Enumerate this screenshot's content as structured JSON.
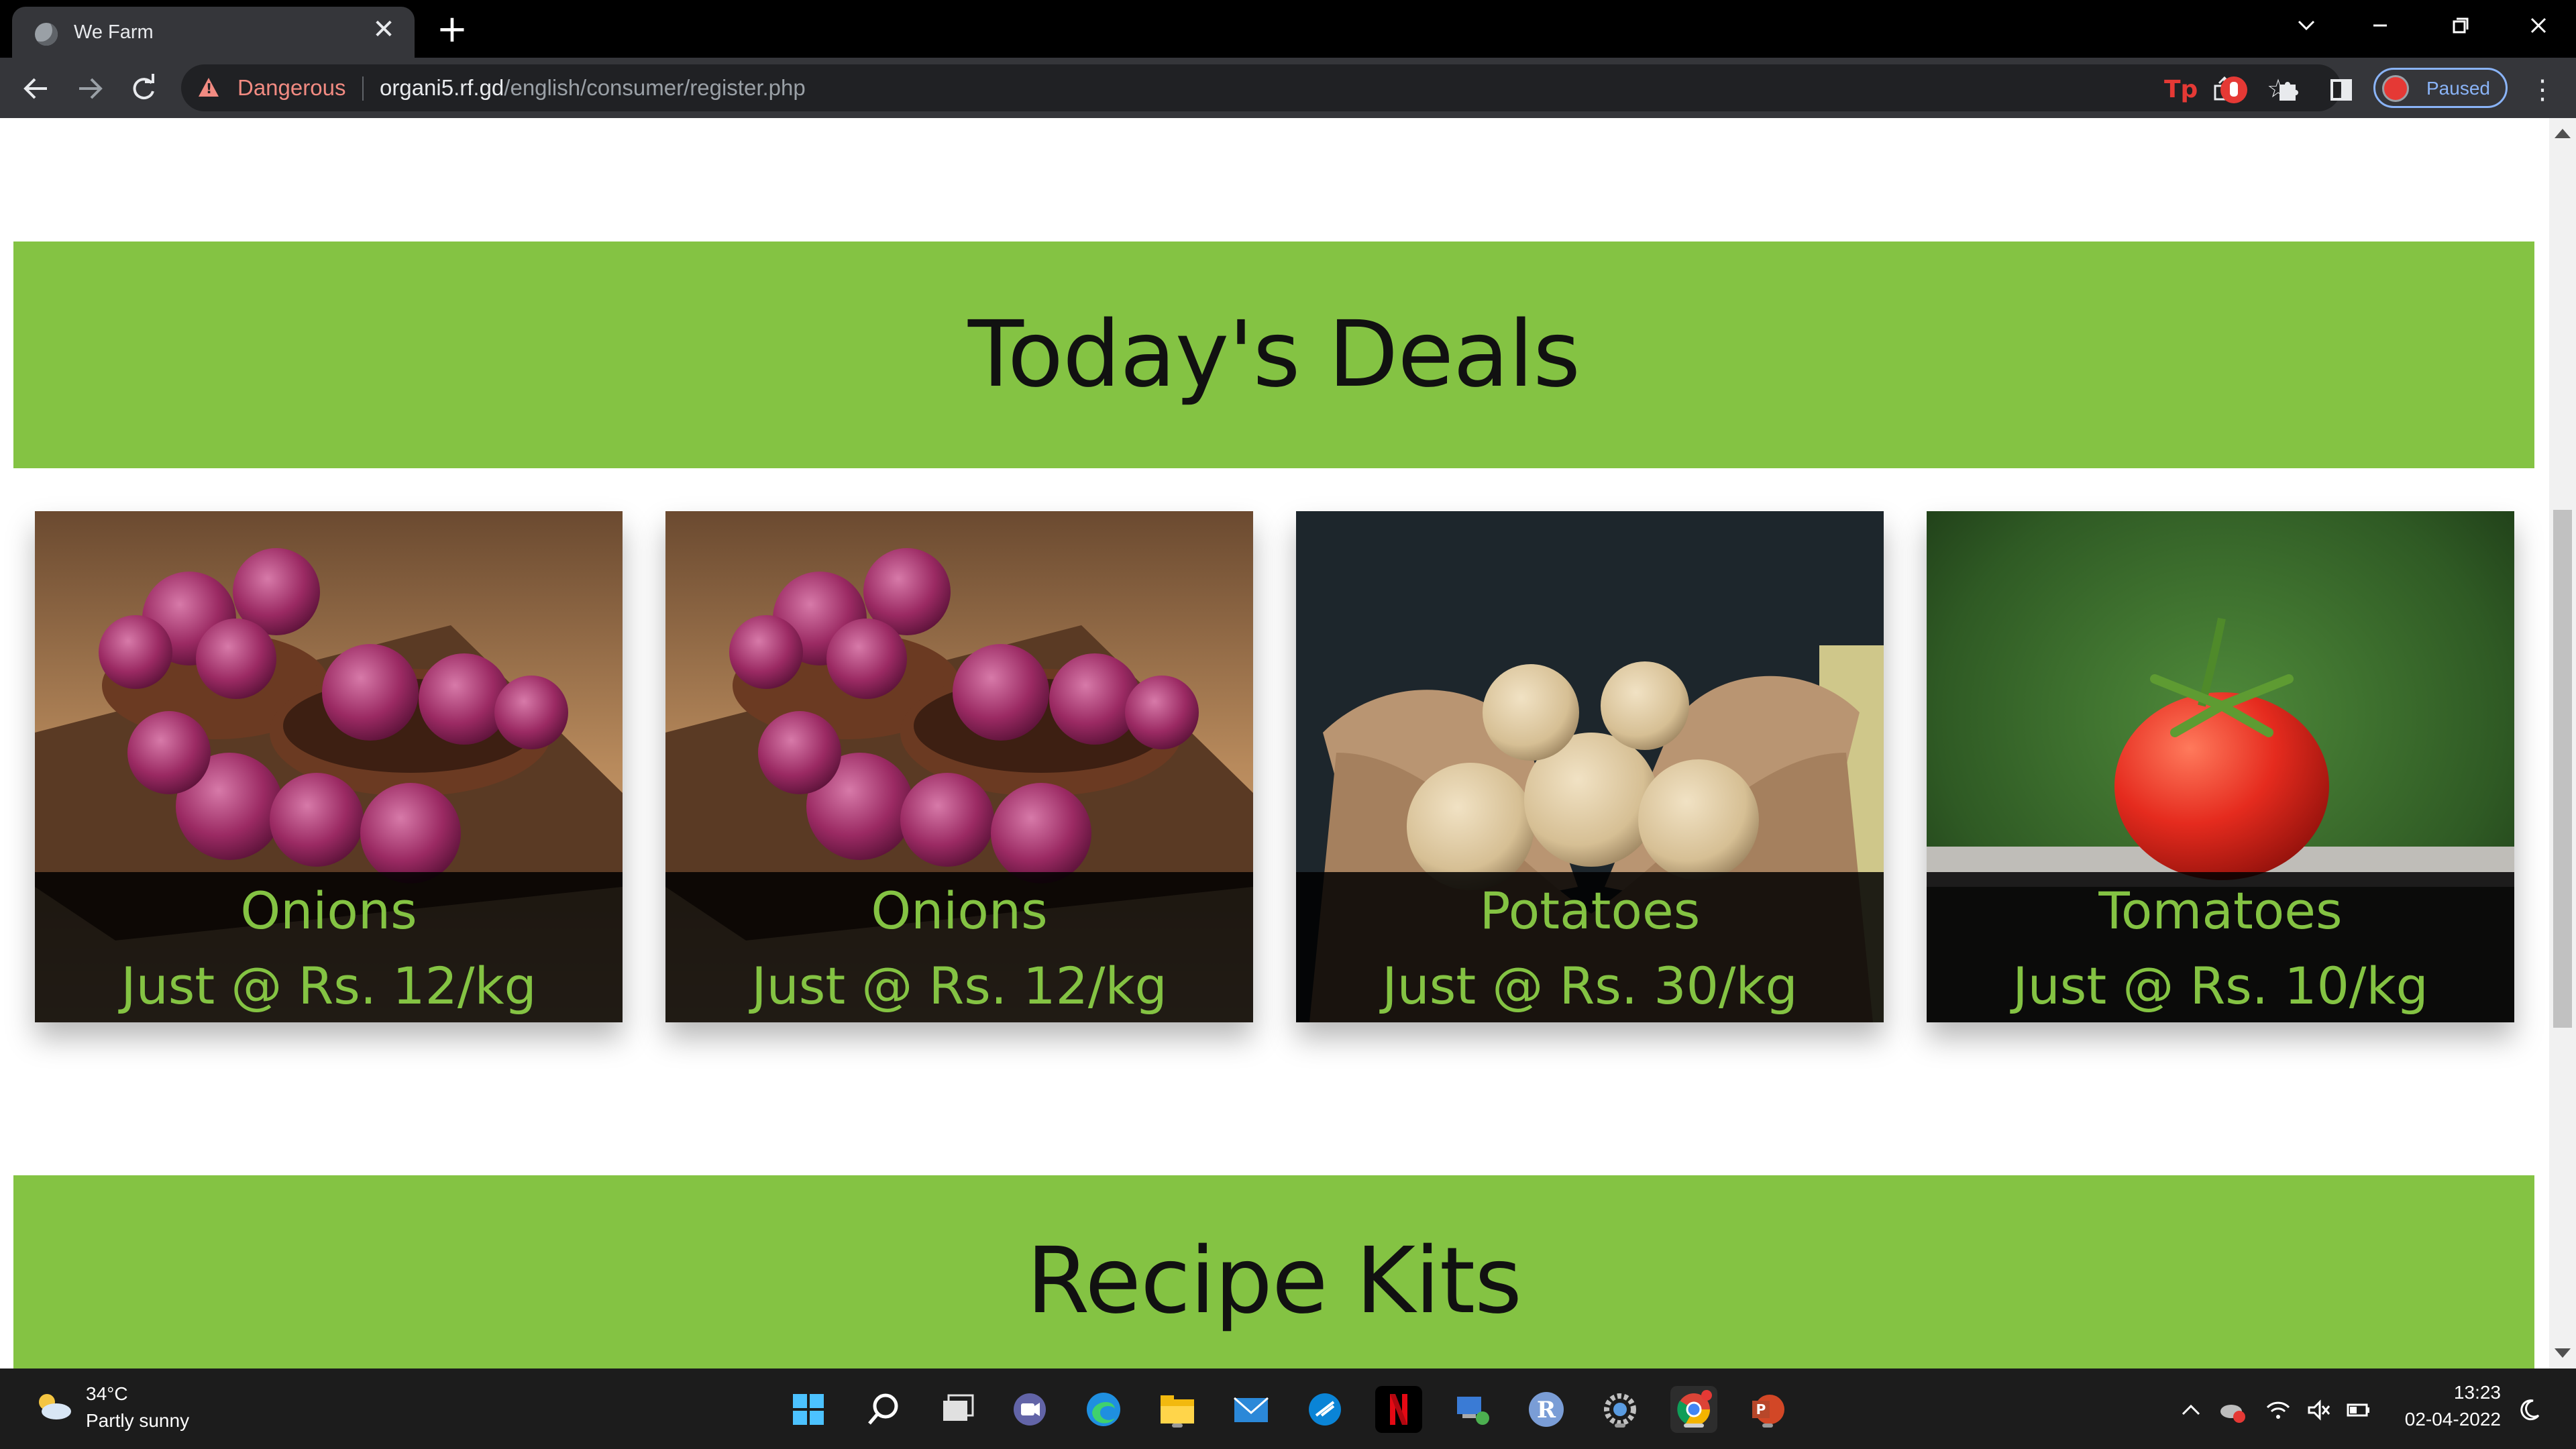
{
  "browser": {
    "tab_title": "We Farm",
    "new_tab_symbol": "+",
    "security_label": "Dangerous",
    "url_host": "organi5.rf.gd",
    "url_path": "/english/consumer/register.php",
    "profile_status": "Paused",
    "accent_color": "#8ab4f8",
    "danger_color": "#f28b82"
  },
  "page": {
    "brand_green": "#84c343",
    "deals_heading": "Today's Deals",
    "recipes_heading": "Recipe Kits",
    "deals": [
      {
        "name": "Onions",
        "price": "Just @ Rs. 12/kg",
        "image": "red-onions-in-bowls"
      },
      {
        "name": "Onions",
        "price": "Just @ Rs. 12/kg",
        "image": "red-onions-in-bowls"
      },
      {
        "name": "Potatoes",
        "price": "Just @ Rs. 30/kg",
        "image": "potatoes-in-hands"
      },
      {
        "name": "Tomatoes",
        "price": "Just @ Rs. 10/kg",
        "image": "tomato-on-vine"
      }
    ]
  },
  "taskbar": {
    "weather_temp": "34°C",
    "weather_desc": "Partly sunny",
    "apps": [
      "start",
      "search",
      "task-view",
      "teams-chat",
      "edge",
      "file-explorer",
      "mail",
      "app-blue",
      "netflix",
      "network-app",
      "r-app",
      "settings",
      "chrome",
      "powerpoint"
    ],
    "time": "13:23",
    "date": "02-04-2022"
  }
}
